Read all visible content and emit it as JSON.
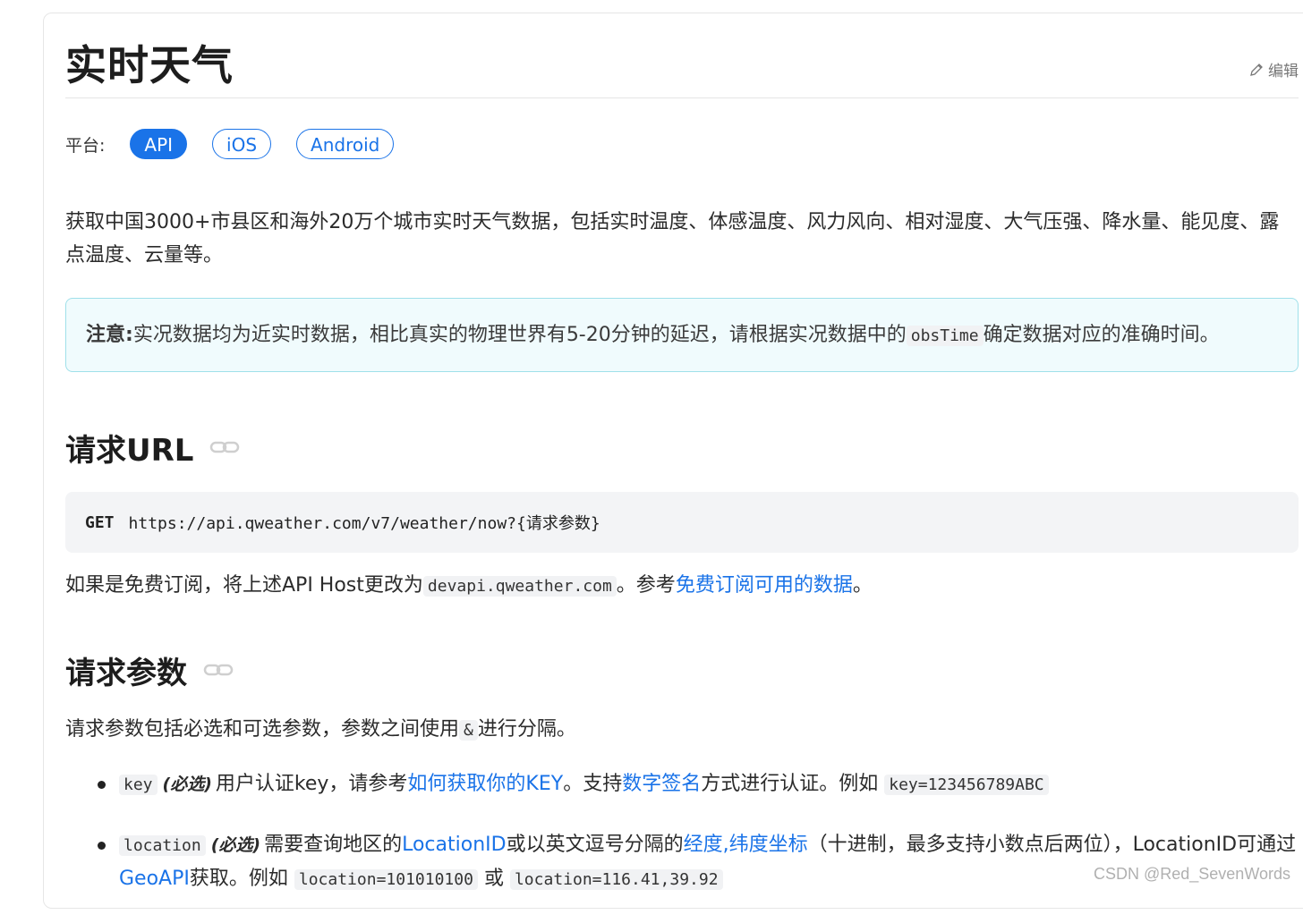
{
  "page": {
    "title": "实时天气",
    "edit_label": "编辑"
  },
  "platform": {
    "label": "平台:",
    "options": [
      "API",
      "iOS",
      "Android"
    ],
    "selected": "API"
  },
  "intro": "获取中国3000+市县区和海外20万个城市实时天气数据，包括实时温度、体感温度、风力风向、相对湿度、大气压强、降水量、能见度、露点温度、云量等。",
  "note": {
    "strong": "注意:",
    "text_before": "实况数据均为近实时数据，相比真实的物理世界有5-20分钟的延迟，请根据实况数据中的",
    "code": "obsTime",
    "text_after": "确定数据对应的准确时间。"
  },
  "request_url": {
    "heading": "请求URL",
    "method": "GET",
    "url": "https://api.qweather.com/v7/weather/now?{请求参数}",
    "free_text_before": "如果是免费订阅，将上述API Host更改为",
    "free_code": "devapi.qweather.com",
    "free_text_mid": "。参考",
    "free_link": "免费订阅可用的数据",
    "free_text_after": "。"
  },
  "params": {
    "heading": "请求参数",
    "intro_before": "请求参数包括必选和可选参数，参数之间使用",
    "intro_code": "&",
    "intro_after": "进行分隔。",
    "items": [
      {
        "name": "key",
        "req": "(必选)",
        "t1": "用户认证key，请参考",
        "link1": "如何获取你的KEY",
        "t2": "。支持",
        "link2": "数字签名",
        "t3": "方式进行认证。例如",
        "example": "key=123456789ABC"
      },
      {
        "name": "location",
        "req": "(必选)",
        "t1": "需要查询地区的",
        "link1": "LocationID",
        "t2": "或以英文逗号分隔的",
        "link2": "经度,纬度坐标",
        "t3": "（十进制，最多支持小数点后两位），LocationID可通过",
        "link3": "GeoAPI",
        "t4": "获取。例如",
        "example1": "location=101010100",
        "or": "或",
        "example2": "location=116.41,39.92"
      }
    ]
  },
  "watermark": "CSDN @Red_SevenWords",
  "colors": {
    "accent": "#1a73e8",
    "note_bg": "#f0fbfd",
    "note_border": "#9fe0ea",
    "code_bg": "#f1f2f4"
  }
}
